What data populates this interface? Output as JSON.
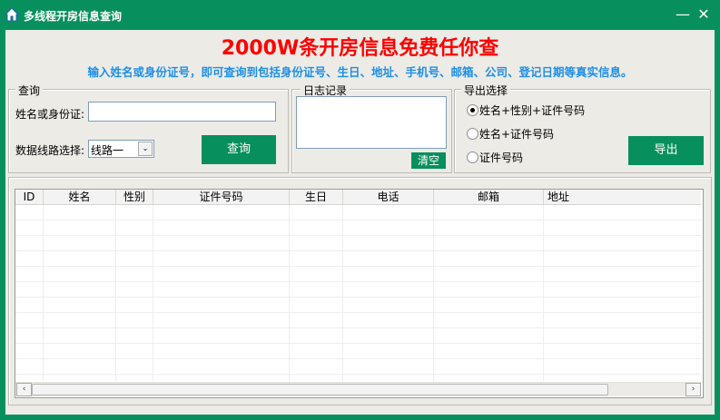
{
  "window": {
    "title": "多线程开房信息查询",
    "minimize": "—",
    "close": "✕"
  },
  "banner": {
    "headline": "2000W条开房信息免费任你查",
    "subline": "输入姓名或身份证号，即可查询到包括身份证号、生日、地址、手机号、邮箱、公司、登记日期等真实信息。"
  },
  "query": {
    "legend": "查询",
    "name_label": "姓名或身份证:",
    "name_value": "",
    "line_label": "数据线路选择:",
    "line_value": "线路一",
    "query_button": "查询"
  },
  "log": {
    "legend": "日志记录",
    "content": "",
    "clear_button": "清空"
  },
  "export": {
    "legend": "导出选择",
    "options": [
      {
        "label": "姓名+性别+证件号码",
        "selected": true
      },
      {
        "label": "姓名+证件号码",
        "selected": false
      },
      {
        "label": "证件号码",
        "selected": false
      }
    ],
    "export_button": "导出"
  },
  "table": {
    "columns": [
      "ID",
      "姓名",
      "性别",
      "证件号码",
      "生日",
      "电话",
      "邮箱",
      "地址"
    ],
    "rows": []
  },
  "colors": {
    "accent": "#07905d",
    "headline": "#ff0000",
    "subline": "#1e8fe6"
  }
}
